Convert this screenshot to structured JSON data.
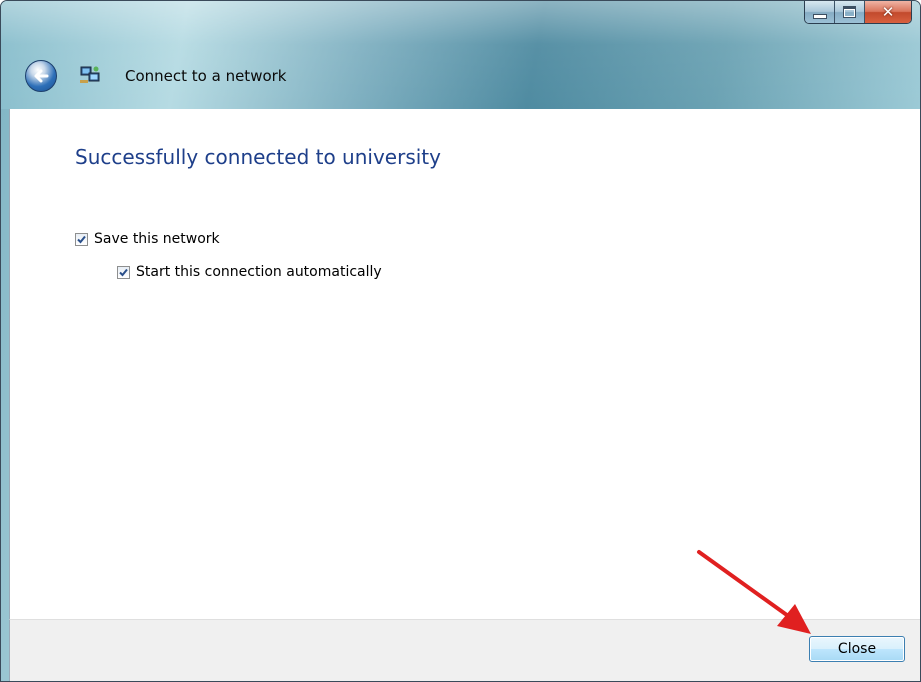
{
  "window": {
    "title": "Connect to a network",
    "minimize_icon": "minimize-icon",
    "maximize_icon": "maximize-icon",
    "close_icon": "close-icon",
    "back_icon": "back-arrow-icon",
    "network_icon": "network-icon"
  },
  "main": {
    "heading": "Successfully connected to university",
    "options": [
      {
        "label": "Save this network",
        "checked": true
      },
      {
        "label": "Start this connection automatically",
        "checked": true
      }
    ]
  },
  "footer": {
    "close_label": "Close"
  },
  "annotation": {
    "arrow_color": "#e02020"
  },
  "colors": {
    "heading": "#1e3f8a",
    "button_border": "#3c7fb1"
  }
}
